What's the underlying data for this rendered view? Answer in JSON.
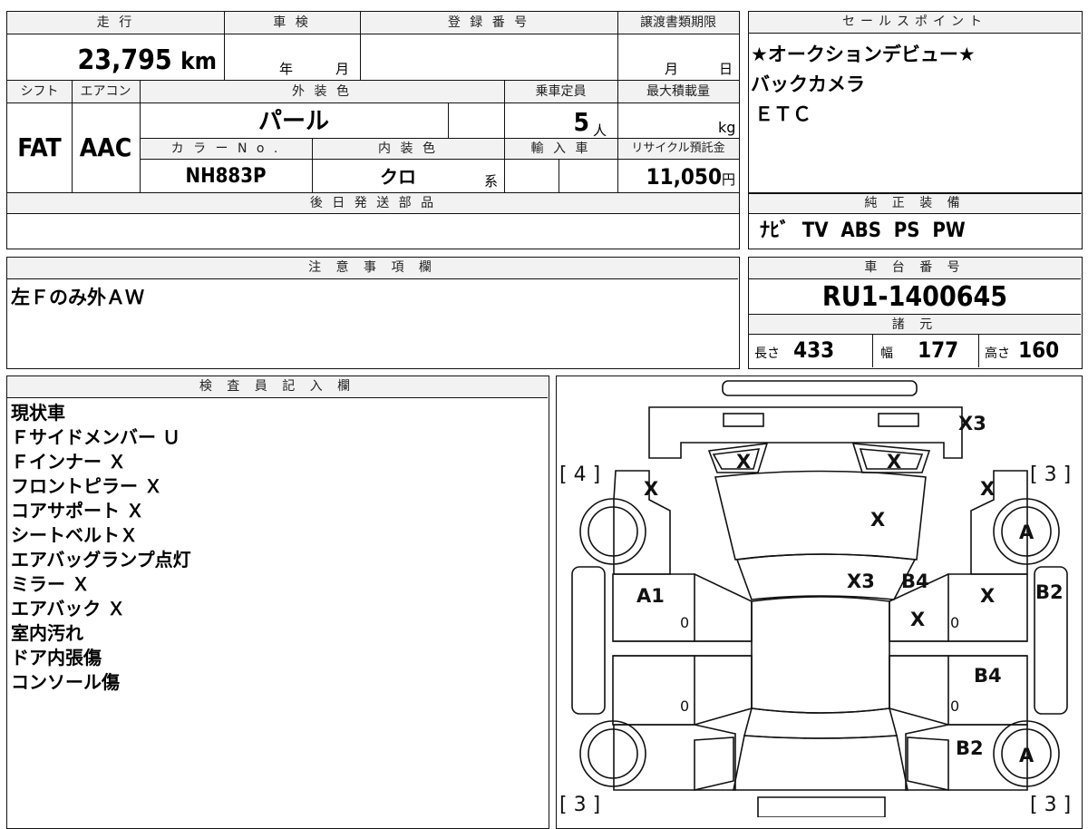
{
  "headers": {
    "mileage": "走 行",
    "inspection": "車 検",
    "registration": "登 録 番 号",
    "transfer": "譲渡書類期限",
    "sales_points": "セールスポイント",
    "shift": "シフト",
    "aircon": "エアコン",
    "exterior_color": "外 装 色",
    "capacity": "乗車定員",
    "max_load": "最大積載量",
    "color_no": "カ ラ ー N o .",
    "interior_color": "内 装 色",
    "imported": "輸 入 車",
    "recycle": "リサイクル預託金",
    "later_parts": "後 日 発 送 部 品",
    "genuine_equipment": "純 正 装 備",
    "notes": "注 意 事 項 欄",
    "chassis_no": "車 台 番 号",
    "specs": "諸 元",
    "inspector": "検 査 員 記 入 欄"
  },
  "vehicle": {
    "mileage": "23,795",
    "mileage_unit": "km",
    "year_label": "年",
    "month_label": "月",
    "transfer_month": "月",
    "transfer_day": "日",
    "shift": "FAT",
    "aircon": "AAC",
    "exterior_color": "パール",
    "capacity": "5",
    "capacity_unit": "人",
    "max_load_unit": "kg",
    "color_no": "NH883P",
    "interior_color": "クロ",
    "interior_suffix": "系",
    "recycle_fee": "11,050",
    "recycle_unit": "円"
  },
  "sales_points": [
    "★オークションデビュー★",
    "バックカメラ",
    "ＥＴＣ"
  ],
  "genuine_equipment": "ﾅﾋﾞ  TV  ABS  PS  PW",
  "notes_text": "左Ｆのみ外ＡＷ",
  "chassis_no": "RU1-1400645",
  "specs": {
    "length_label": "長さ",
    "length": "433",
    "width_label": "幅",
    "width": "177",
    "height_label": "高さ",
    "height": "160"
  },
  "inspector_notes": [
    "現状車",
    "Ｆサイドメンバー Ｕ",
    "Ｆインナー Ｘ",
    "フロントピラー Ｘ",
    "コアサポート Ｘ",
    "シートベルトＸ",
    "エアバッグランプ点灯",
    "ミラー Ｘ",
    "エアバック Ｘ",
    "室内汚れ",
    "ドア内張傷",
    "コンソール傷"
  ],
  "diagram": {
    "brackets": {
      "front_left": "[ 4 ]",
      "front_right": "[ 3 ]",
      "rear_left": "[ 3 ]",
      "rear_right": "[ 3 ]"
    },
    "marks": {
      "bumper_front": "X3",
      "glass_left": "X",
      "glass_right": "X",
      "fender_front_left": "X",
      "fender_front_right": "X",
      "hood": "X",
      "windshield": "X3",
      "pillar_right": "B4",
      "door_front_right_a": "X",
      "door_front_right_b": "X",
      "door_front_left": "A1",
      "tire_front_right": "A",
      "side_right_front": "B2",
      "door_rear_right": "B4",
      "quarter_right": "B2",
      "tire_rear_right": "A"
    },
    "zeros": [
      "0",
      "0",
      "0",
      "0"
    ]
  }
}
